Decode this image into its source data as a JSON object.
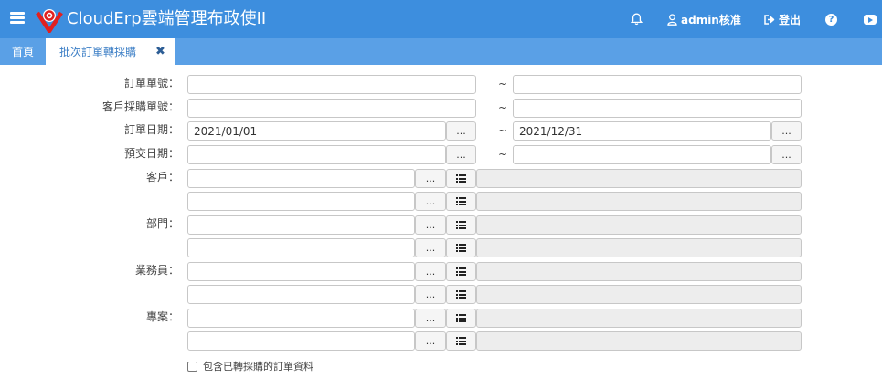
{
  "app": {
    "title": "CloudErp雲端管理布政使II",
    "brand_color": "#3d8ede",
    "tabbar_color": "#5aa0e6",
    "logo_color": "#e02020"
  },
  "topbar": {
    "bell_icon": "bell-icon",
    "user_label": "admin核准",
    "user_icon": "user-icon",
    "logout_label": "登出",
    "logout_icon": "sign-out-icon",
    "help_icon": "question-circle-icon",
    "help_glyph": "?",
    "youtube_icon": "youtube-icon"
  },
  "tabs": {
    "home": "首頁",
    "active": "批次訂單轉採購",
    "close": "✖"
  },
  "form": {
    "order_no": {
      "label": "訂單單號：",
      "from": "",
      "to": ""
    },
    "customer_po": {
      "label": "客戶採購單號：",
      "from": "",
      "to": ""
    },
    "order_date": {
      "label": "訂單日期：",
      "from": "2021/01/01",
      "to": "2021/12/31"
    },
    "delivery_date": {
      "label": "預交日期：",
      "from": "",
      "to": ""
    },
    "tilde": "~",
    "ellipsis": "...",
    "customer": {
      "label": "客戶："
    },
    "department": {
      "label": "部門："
    },
    "salesperson": {
      "label": "業務員："
    },
    "project": {
      "label": "專案："
    },
    "include_converted": {
      "label": "包含已轉採購的訂單資料",
      "checked": false
    }
  }
}
